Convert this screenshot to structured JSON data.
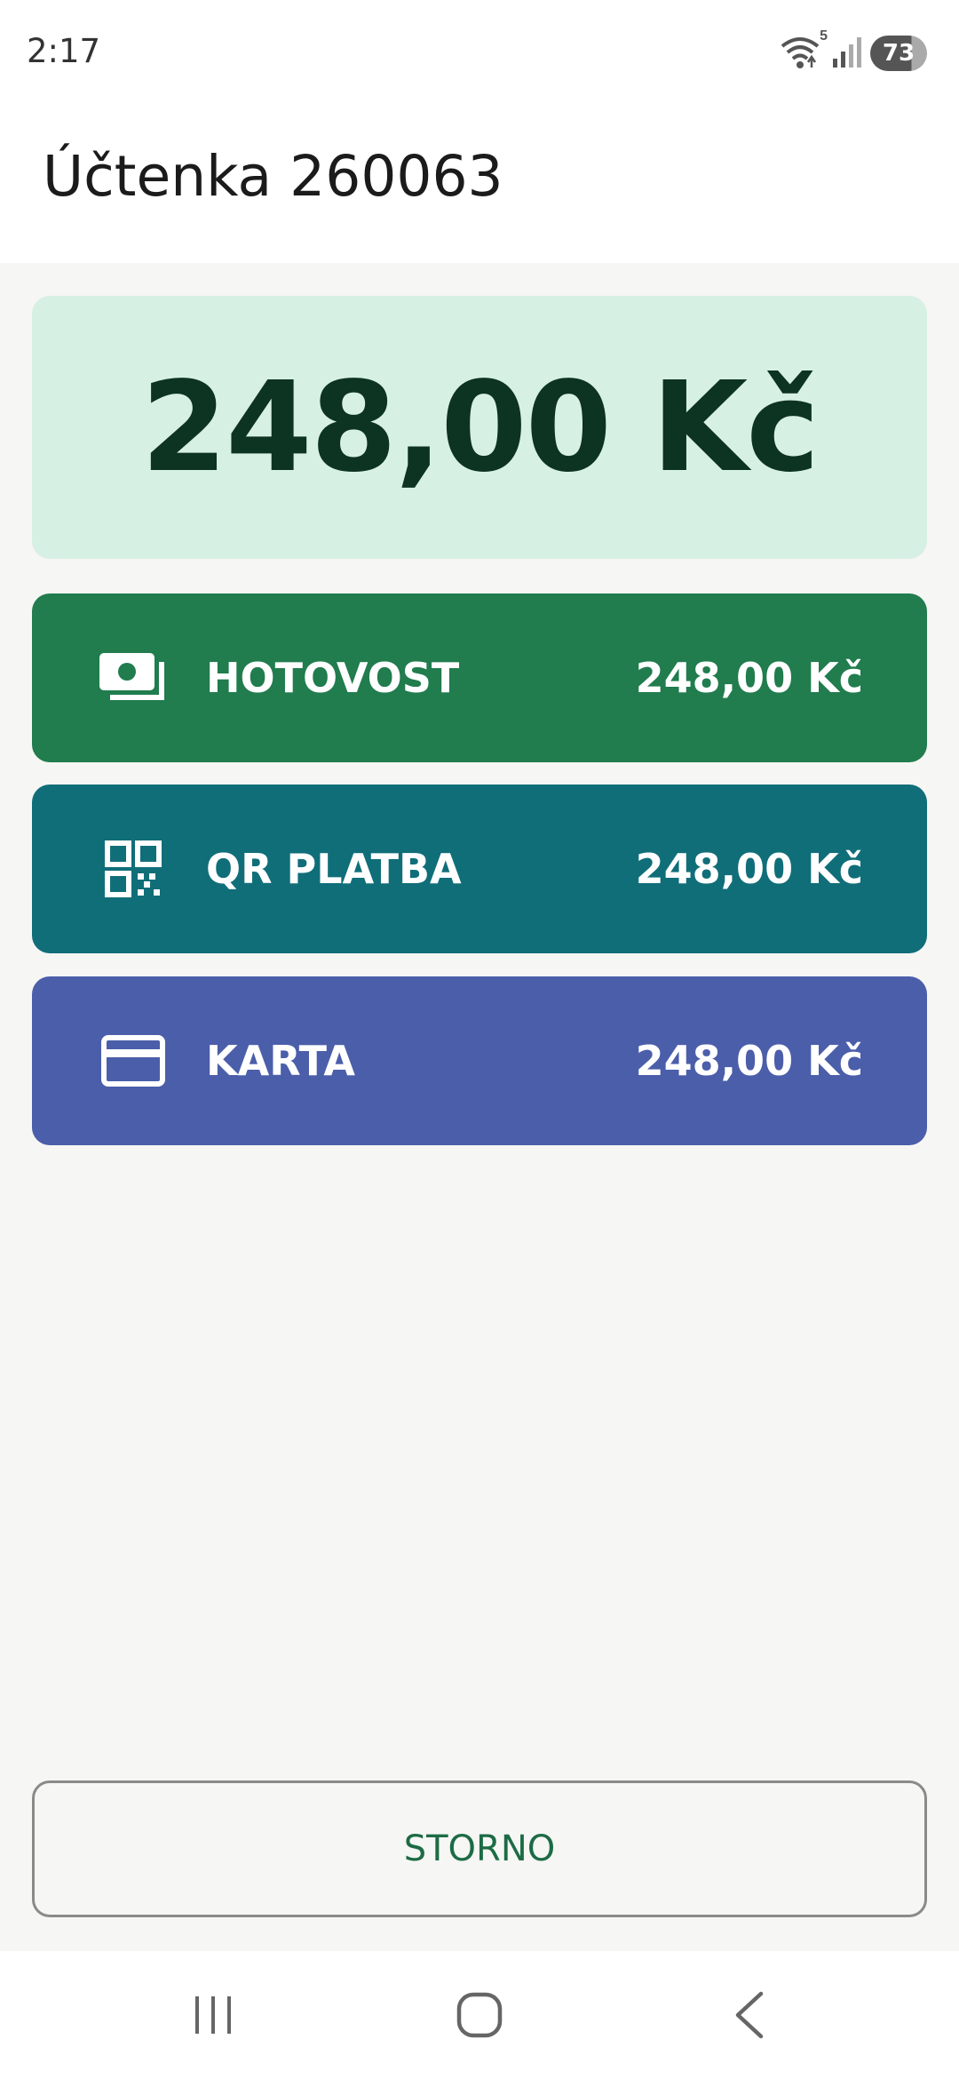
{
  "status_bar": {
    "time": "2:17",
    "battery": "73",
    "wifi_badge": "5"
  },
  "header": {
    "title": "Účtenka 260063"
  },
  "total": {
    "amount": "248,00 Kč"
  },
  "payment_methods": [
    {
      "label": "HOTOVOST",
      "amount": "248,00 Kč",
      "icon": "cash-icon",
      "color": "#217c4e"
    },
    {
      "label": "QR PLATBA",
      "amount": "248,00 Kč",
      "icon": "qr-code-icon",
      "color": "#106e79"
    },
    {
      "label": "KARTA",
      "amount": "248,00 Kč",
      "icon": "credit-card-icon",
      "color": "#4b5eaa"
    }
  ],
  "actions": {
    "storno_label": "STORNO"
  },
  "colors": {
    "total_bg": "#d7f0e4",
    "total_text": "#0d3322",
    "storno_text": "#1c6b45",
    "page_bg": "#f6f6f4"
  }
}
